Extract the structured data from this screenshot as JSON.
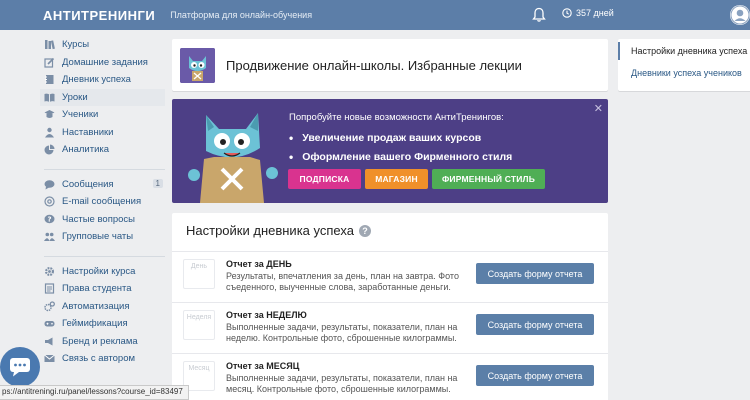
{
  "header": {
    "logo": "AНТИТРЕНИНГИ",
    "tagline": "Платформа для онлайн-обучения",
    "days": "357 дней"
  },
  "sidebar": {
    "groups": [
      [
        {
          "label": "Курсы",
          "icon": "books-icon"
        },
        {
          "label": "Домашние задания",
          "icon": "edit-icon"
        },
        {
          "label": "Дневник успеха",
          "icon": "notebook-icon"
        },
        {
          "label": "Уроки",
          "icon": "book-open-icon",
          "active": true
        },
        {
          "label": "Ученики",
          "icon": "student-icon"
        },
        {
          "label": "Наставники",
          "icon": "mentors-icon"
        },
        {
          "label": "Аналитика",
          "icon": "pie-chart-icon"
        }
      ],
      [
        {
          "label": "Сообщения",
          "icon": "chat-icon",
          "count": "1"
        },
        {
          "label": "E-mail сообщения",
          "icon": "at-icon"
        },
        {
          "label": "Частые вопросы",
          "icon": "question-icon"
        },
        {
          "label": "Групповые чаты",
          "icon": "group-icon"
        }
      ],
      [
        {
          "label": "Настройки курса",
          "icon": "gear-icon"
        },
        {
          "label": "Права студента",
          "icon": "document-icon"
        },
        {
          "label": "Автоматизация",
          "icon": "automation-icon"
        },
        {
          "label": "Геймификация",
          "icon": "gamepad-icon"
        },
        {
          "label": "Бренд и реклама",
          "icon": "brand-icon"
        },
        {
          "label": "Связь с автором",
          "icon": "mail-icon"
        }
      ]
    ]
  },
  "course": {
    "title": "Продвижение онлайн-школы. Избранные лекции"
  },
  "promo": {
    "heading": "Попробуйте новые возможности АнтиТренингов:",
    "bullets": [
      "Увеличение продаж ваших курсов",
      "Оформление вашего Фирменного стиля"
    ],
    "btn_subscribe": "ПОДПИСКА",
    "btn_shop": "МАГАЗИН",
    "btn_style": "ФИРМЕННЫЙ СТИЛЬ",
    "close": "✕"
  },
  "settings": {
    "title": "Настройки дневника успеха",
    "help": "?",
    "reports": [
      {
        "icon_label": "День",
        "name": "Отчет за ДЕНЬ",
        "desc": "Результаты, впечатления за день, план на завтра. Фото съеденного, выученные слова, заработанные деньги.",
        "button": "Создать форму отчета"
      },
      {
        "icon_label": "Неделя",
        "name": "Отчет за НЕДЕЛЮ",
        "desc": "Выполненные задачи, результаты, показатели, план на неделю. Контрольные фото, сброшенные килограммы.",
        "button": "Создать форму отчета"
      },
      {
        "icon_label": "Месяц",
        "name": "Отчет за МЕСЯЦ",
        "desc": "Выполненные задачи, результаты, показатели, план на месяц. Контрольные фото, сброшенные килограммы.",
        "button": "Создать форму отчета"
      }
    ]
  },
  "right_nav": {
    "items": [
      {
        "label": "Настройки дневника успеха",
        "active": true
      },
      {
        "label": "Дневники успеха учеников",
        "active": false
      }
    ]
  },
  "status_url": "ps://antitreningi.ru/panel/lessons?course_id=83497",
  "colors": {
    "topbar": "#5c7ea8",
    "promo_bg": "#4d3f86",
    "subscribe": "#d9338f",
    "shop": "#f0902a",
    "style": "#4fae55",
    "create_button": "#5b7fa8"
  }
}
